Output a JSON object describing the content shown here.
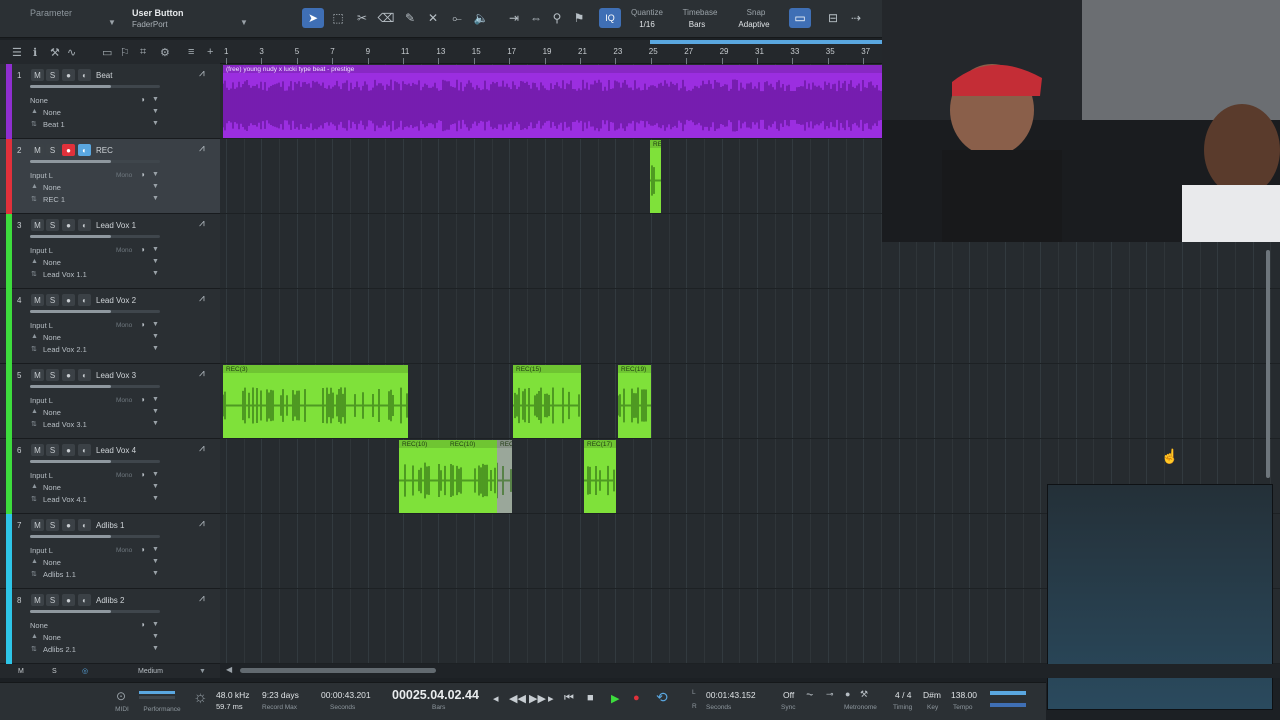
{
  "toolbar": {
    "parameter_label": "Parameter",
    "user_button_title": "User Button",
    "user_button_sub": "FaderPort",
    "quantize_label": "Quantize",
    "quantize_value": "1/16",
    "timebase_label": "Timebase",
    "timebase_value": "Bars",
    "snap_label": "Snap",
    "snap_value": "Adaptive",
    "iq_label": "IQ"
  },
  "ruler": {
    "bars": [
      "1",
      "3",
      "5",
      "7",
      "9",
      "11",
      "13",
      "15",
      "17",
      "19",
      "21",
      "23",
      "25",
      "27",
      "29",
      "31",
      "33",
      "35",
      "37"
    ]
  },
  "tracks": [
    {
      "num": "1",
      "name": "Beat",
      "input": "None",
      "row2": "None",
      "playlist": "Beat 1",
      "color": "#8f2fd0",
      "selected": false,
      "rec": false,
      "mon": false,
      "mono_label": ""
    },
    {
      "num": "2",
      "name": "REC",
      "input": "Input L",
      "row2": "None",
      "playlist": "REC 1",
      "color": "#e0313b",
      "selected": true,
      "rec": true,
      "mon": true,
      "mono_label": "Mono"
    },
    {
      "num": "3",
      "name": "Lead Vox 1",
      "input": "Input L",
      "row2": "None",
      "playlist": "Lead Vox 1.1",
      "color": "#3ddc3d",
      "selected": false,
      "rec": false,
      "mon": false,
      "mono_label": "Mono"
    },
    {
      "num": "4",
      "name": "Lead Vox 2",
      "input": "Input L",
      "row2": "None",
      "playlist": "Lead Vox 2.1",
      "color": "#3ddc3d",
      "selected": false,
      "rec": false,
      "mon": false,
      "mono_label": "Mono"
    },
    {
      "num": "5",
      "name": "Lead Vox 3",
      "input": "Input L",
      "row2": "None",
      "playlist": "Lead Vox 3.1",
      "color": "#3ddc3d",
      "selected": false,
      "rec": false,
      "mon": false,
      "mono_label": "Mono"
    },
    {
      "num": "6",
      "name": "Lead Vox 4",
      "input": "Input L",
      "row2": "None",
      "playlist": "Lead Vox 4.1",
      "color": "#3ddc3d",
      "selected": false,
      "rec": false,
      "mon": false,
      "mono_label": "Mono"
    },
    {
      "num": "7",
      "name": "Adlibs 1",
      "input": "Input L",
      "row2": "None",
      "playlist": "Adlibs 1.1",
      "color": "#2ec5e8",
      "selected": false,
      "rec": false,
      "mon": false,
      "mono_label": "Mono"
    },
    {
      "num": "8",
      "name": "Adlibs 2",
      "input": "None",
      "row2": "None",
      "playlist": "Adlibs 2.1",
      "color": "#2ec5e8",
      "selected": false,
      "rec": false,
      "mon": false,
      "mono_label": ""
    }
  ],
  "clips": [
    {
      "track": 0,
      "label": "(free) young nudy x lucki type beat - prestige",
      "color": "#9b2ee0"
    },
    {
      "track": 1,
      "label": "RE",
      "color": "#7fe13a"
    },
    {
      "track": 4,
      "label": "REC(3)",
      "color": "#7fe13a"
    },
    {
      "track": 4,
      "label": "REC(15)",
      "color": "#7fe13a"
    },
    {
      "track": 4,
      "label": "REC(19)",
      "color": "#7fe13a"
    },
    {
      "track": 5,
      "label": "REC(10)",
      "color": "#7fe13a"
    },
    {
      "track": 5,
      "label": "REC(10)",
      "color": "#7fe13a"
    },
    {
      "track": 5,
      "label": "REC",
      "color": "#9aa79a"
    },
    {
      "track": 5,
      "label": "REC(17)",
      "color": "#7fe13a"
    }
  ],
  "footer": {
    "m_label": "M",
    "s_label": "S",
    "size_label": "Medium"
  },
  "transport": {
    "midi_label": "MIDI",
    "performance_label": "Performance",
    "sample_rate": "48.0 kHz",
    "latency": "59.7 ms",
    "record_days": "9:23 days",
    "record_max_label": "Record Max",
    "seconds_time": "00:00:43.201",
    "seconds_label": "Seconds",
    "bars_time": "00025.04.02.44",
    "bars_label": "Bars",
    "loop_end_time": "00:01:43.152",
    "loop_seconds_label": "Seconds",
    "loop_l": "L",
    "loop_r": "R",
    "sync_value": "Off",
    "sync_label": "Sync",
    "metronome_label": "Metronome",
    "timing_value": "4 / 4",
    "timing_label": "Timing",
    "key_value": "D#m",
    "key_label": "Key",
    "tempo_value": "138.00",
    "tempo_label": "Tempo"
  }
}
